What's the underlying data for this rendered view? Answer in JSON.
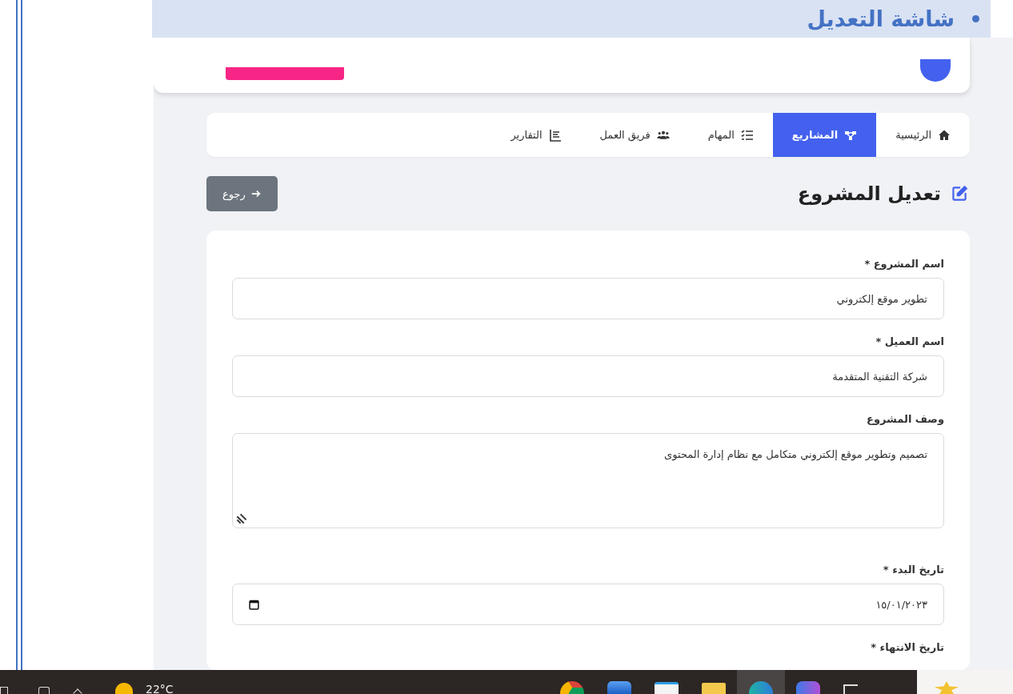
{
  "doc_heading": {
    "text": "شاشة التعديل"
  },
  "nav": {
    "tabs": [
      {
        "label": "الرئيسية",
        "selected": false
      },
      {
        "label": "المشاريع",
        "selected": true
      },
      {
        "label": "المهام",
        "selected": false
      },
      {
        "label": "فريق العمل",
        "selected": false
      },
      {
        "label": "التقارير",
        "selected": false
      }
    ]
  },
  "page_title": "تعديل المشروع",
  "back_button": "رجوع",
  "form": {
    "fields": [
      {
        "kind": "text",
        "label": "اسم المشروع *",
        "value": "تطوير موقع إلكتروني"
      },
      {
        "kind": "text",
        "label": "اسم العميل *",
        "value": "شركة التقنية المتقدمة"
      },
      {
        "kind": "textarea",
        "label": "وصف المشروع",
        "value": "تصميم وتطوير موقع إلكتروني متكامل مع نظام إدارة المحتوى"
      },
      {
        "kind": "date",
        "label": "تاريخ البدء *",
        "value": "١٥/٠١/٢٠٢٣"
      },
      {
        "kind": "cut",
        "label": "تاريخ الانتهاء *"
      }
    ]
  },
  "taskbar": {
    "weather": "22°C"
  }
}
